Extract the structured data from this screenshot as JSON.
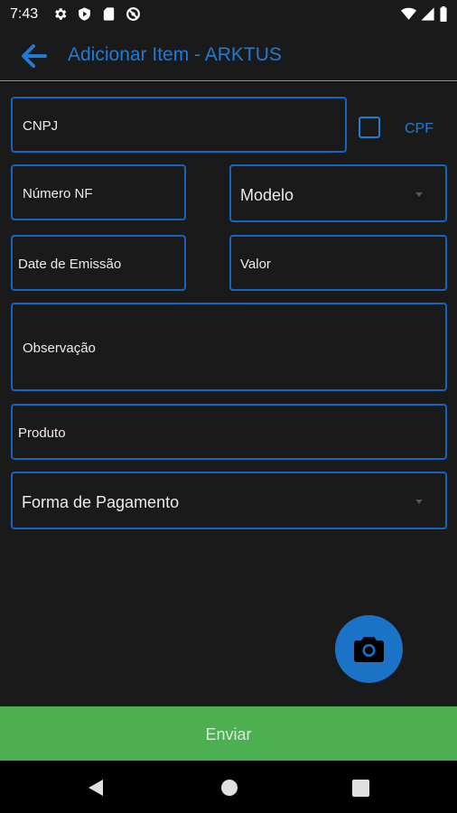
{
  "status_bar": {
    "time": "7:43",
    "icons_left": [
      "gear-icon",
      "play-protect-icon",
      "sd-card-icon",
      "vpn-icon"
    ],
    "icons_right": [
      "wifi-icon",
      "signal-icon",
      "battery-icon"
    ]
  },
  "app_bar": {
    "title": "Adicionar Item - ARKTUS",
    "back_icon": "arrow-left-icon"
  },
  "form": {
    "cnpj_placeholder": "CNPJ",
    "cpf_label": "CPF",
    "numero_nf_placeholder": "Número NF",
    "modelo_label": "Modelo",
    "data_emissao_placeholder": "Date de Emissão",
    "valor_placeholder": "Valor",
    "observacao_placeholder": "Observação",
    "produto_placeholder": "Produto",
    "forma_pagamento_label": "Forma de Pagamento"
  },
  "fab": {
    "icon": "camera-icon"
  },
  "submit": {
    "label": "Enviar"
  },
  "nav_bar": {
    "icons": [
      "back-triangle-icon",
      "home-circle-icon",
      "recents-square-icon"
    ]
  },
  "colors": {
    "accent": "#1f7bd3",
    "border": "#1565c0",
    "background": "#1a1a1a",
    "submit_bg": "#4caf50",
    "fab_bg": "#1a73c6"
  }
}
